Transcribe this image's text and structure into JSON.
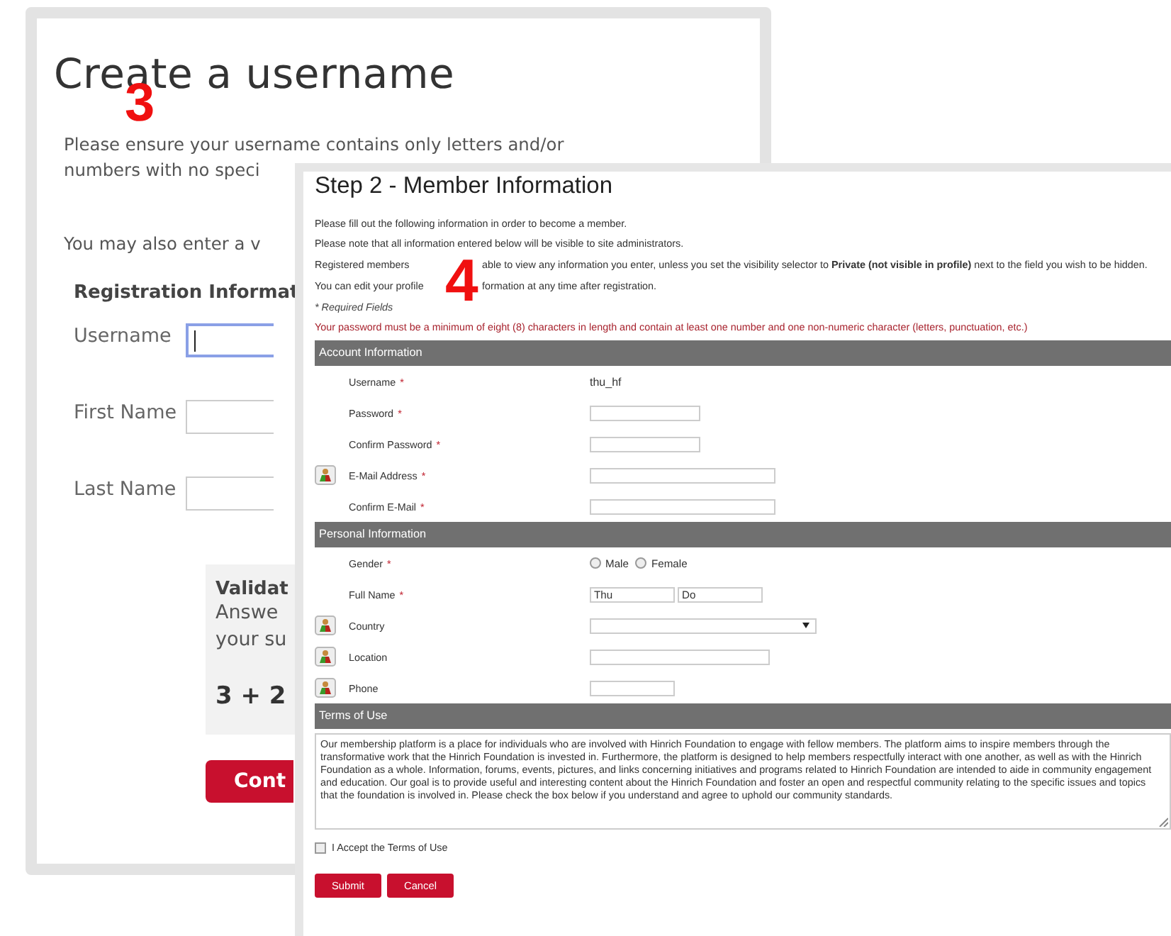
{
  "back_window": {
    "title": "Create a username",
    "step_number": "3",
    "instructions": [
      "Please ensure your username contains only letters and/or",
      "numbers with no speci"
    ],
    "also_enter": "You may also enter a v",
    "section_title": "Registration Informat",
    "fields": [
      {
        "label": "Username",
        "focused": true
      },
      {
        "label": "First Name",
        "focused": false
      },
      {
        "label": "Last Name",
        "focused": false
      }
    ],
    "validation": {
      "title": "Validat",
      "lines": [
        "Answe",
        "your su"
      ],
      "question": "3 + 2"
    },
    "continue_button": "Cont"
  },
  "front_window": {
    "title": "Step 2 - Member Information",
    "step_number": "4",
    "paragraphs": [
      {
        "parts": [
          "Please fill out the following information in order to become a member."
        ]
      },
      {
        "parts": [
          "Please note that all information entered below will be visible to site administrators."
        ]
      },
      {
        "parts": [
          "Registered members",
          "able to view any information you enter, unless you set the visibility selector to **Private (not visible in profile)** next to the field you wish to be hidden."
        ]
      },
      {
        "parts": [
          "You can edit your profile",
          "formation at any time after registration."
        ]
      }
    ],
    "required_note": "* Required Fields",
    "password_rule": "Your password must be a minimum of eight (8) characters in length and contain at least one number and one non-numeric character (letters, punctuation, etc.)",
    "sections": [
      {
        "title": "Account Information",
        "rows": [
          {
            "kind": "static",
            "label": "Username",
            "required_mark": "*",
            "value": "thu_hf",
            "visibility_icon": false
          },
          {
            "kind": "password",
            "label": "Password",
            "required_mark": "*",
            "visibility_icon": false
          },
          {
            "kind": "password",
            "label": "Confirm Password",
            "required_mark": "*",
            "visibility_icon": false
          },
          {
            "kind": "email",
            "label": "E-Mail Address",
            "required_mark": "*",
            "visibility_icon": true
          },
          {
            "kind": "email",
            "label": "Confirm E-Mail",
            "required_mark": "*",
            "visibility_icon": false
          }
        ]
      },
      {
        "title": "Personal Information",
        "rows": [
          {
            "kind": "radio",
            "label": "Gender",
            "required_mark": "*",
            "visibility_icon": false,
            "options": [
              {
                "label": "Male",
                "selected": false
              },
              {
                "label": "Female",
                "selected": false
              }
            ]
          },
          {
            "kind": "name",
            "label": "Full Name",
            "required_mark": "*",
            "visibility_icon": false,
            "values": [
              "Thu",
              "Do"
            ]
          },
          {
            "kind": "select",
            "label": "Country",
            "visibility_icon": true
          },
          {
            "kind": "text",
            "label": "Location",
            "visibility_icon": true
          },
          {
            "kind": "phone",
            "label": "Phone",
            "visibility_icon": true
          }
        ]
      }
    ],
    "terms_title": "Terms of Use",
    "terms_text": "Our membership platform is a place for individuals who are involved with Hinrich Foundation to engage with fellow members. The platform aims to inspire members through the transformative work that the Hinrich Foundation is invested in. Furthermore, the platform is designed to help members respectfully interact with one another, as well as with the Hinrich Foundation as a whole. Information, forums, events, pictures, and links concerning initiatives and programs related to Hinrich Foundation are intended to aide in community engagement and education. Our goal is to provide useful and interesting content about the Hinrich Foundation and foster an open and respectful community relating to the specific issues and topics that the foundation is involved in. Please check the box below if you understand and agree to uphold our community standards.",
    "accept": {
      "label": "I Accept the Terms of Use",
      "checked": false
    },
    "buttons": [
      "Submit",
      "Cancel"
    ]
  }
}
